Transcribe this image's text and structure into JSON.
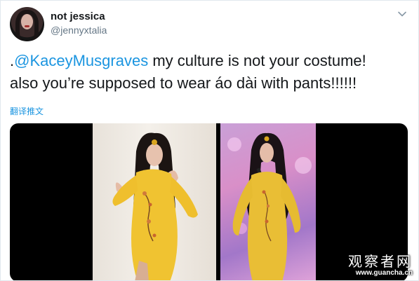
{
  "tweet": {
    "author": {
      "display_name": "not jessica",
      "handle": "@jennyxtalia"
    },
    "text": {
      "prefix": ".",
      "mention": "@KaceyMusgraves",
      "body_line1": " my culture is not your costume!",
      "body_line2": "also you’re supposed to wear áo dài with pants!!!!!!"
    },
    "translate_label": "翻译推文",
    "media": {
      "photos": [
        {
          "name": "stage-photo-studio",
          "dress_color": "#f0c331"
        },
        {
          "name": "stage-photo-concert",
          "dress_color": "#e9be35"
        }
      ]
    }
  },
  "watermark": {
    "main": "观察者网",
    "url": "www.guancha.cn"
  },
  "icons": {
    "menu": "chevron-down-icon"
  },
  "colors": {
    "link": "#1b95e0",
    "text": "#14171a",
    "secondary": "#657786"
  }
}
